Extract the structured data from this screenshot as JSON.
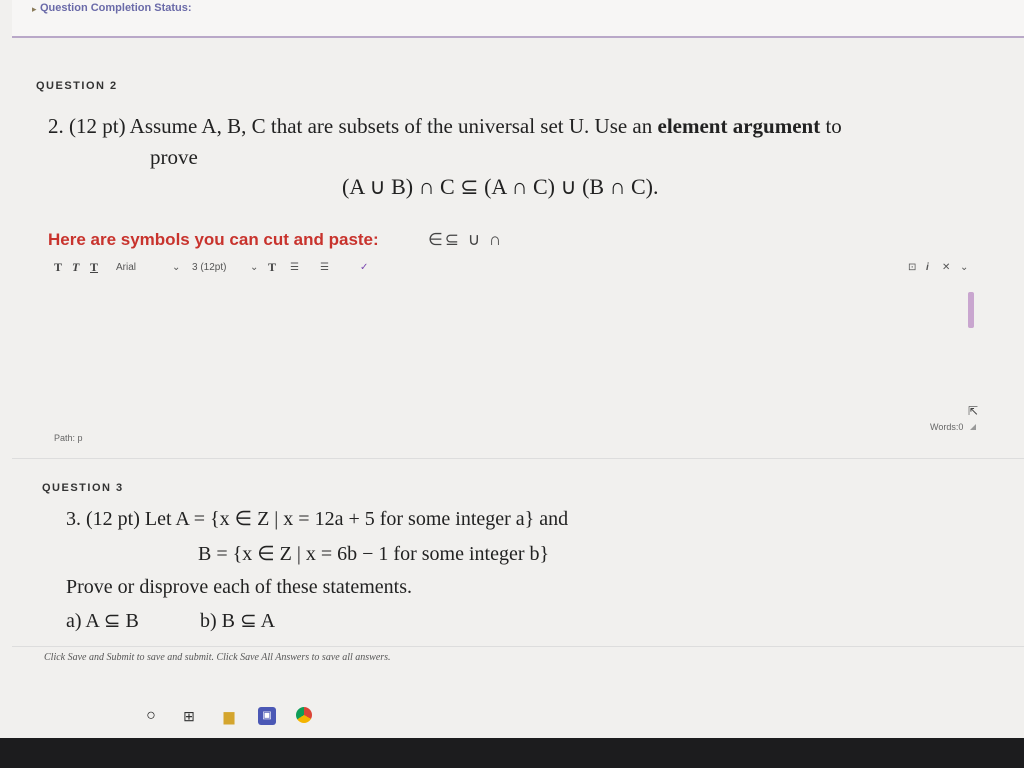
{
  "status": {
    "label": "Question Completion Status:",
    "arrow": "▸"
  },
  "question2": {
    "heading": "QUESTION 2",
    "number": "2. (12 pt)",
    "text_before": "Assume A, B, C that are subsets of the universal set U. Use an",
    "bold": "element argument",
    "text_after": "to",
    "line2": "prove",
    "formula": "(A ∪ B) ∩ C ⊆ (A ∩ C) ∪ (B ∩ C)."
  },
  "hint": {
    "label": "Here are symbols you can cut and paste:",
    "symbols": "∈⊆ ∪ ∩"
  },
  "toolbar": {
    "format_buttons": [
      "T",
      "T",
      "T"
    ],
    "font": "Arial",
    "size": "3 (12pt)",
    "text_color": "T",
    "list1": "☰",
    "list2": "☰",
    "spell": "✓",
    "right_icons": [
      "⊡",
      "i",
      "✕",
      "⌄"
    ]
  },
  "editor": {
    "path": "Path: p",
    "words": "Words:0"
  },
  "question3": {
    "heading": "QUESTION 3",
    "line1": "3. (12 pt) Let A = {x ∈ Z | x = 12a + 5 for some integer a} and",
    "line2": "B = {x ∈ Z | x = 6b − 1 for some integer b}",
    "line3": "Prove or disprove each of these statements.",
    "line4a": "a) A ⊆ B",
    "line4b": "b) B ⊆ A"
  },
  "footer": {
    "note": "Click Save and Submit to save and submit. Click Save All Answers to save all answers."
  },
  "taskbar": {
    "icons": [
      "circle-icon",
      "task-view-icon",
      "file-explorer-icon",
      "teams-icon",
      "chrome-icon"
    ]
  }
}
